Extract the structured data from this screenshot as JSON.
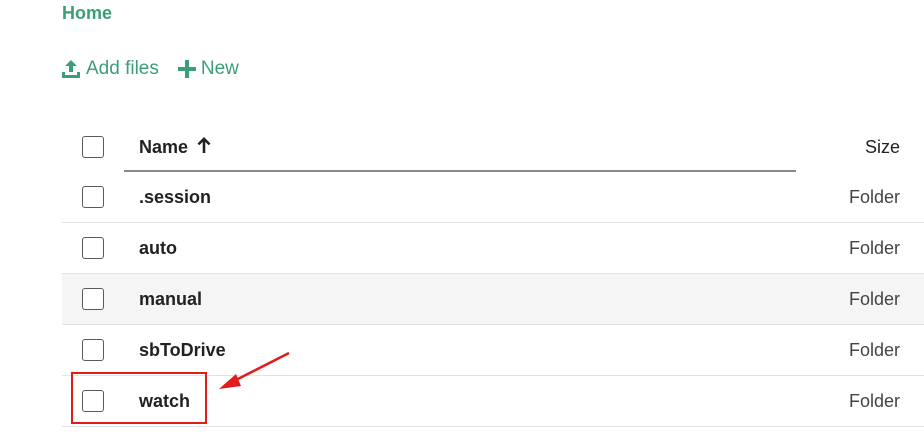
{
  "breadcrumb": {
    "label": "Home"
  },
  "toolbar": {
    "add_files_label": "Add files",
    "new_label": "New"
  },
  "table": {
    "columns": {
      "name": "Name",
      "size": "Size",
      "sort_direction": "ascending"
    },
    "rows": [
      {
        "name": ".session",
        "size": "Folder"
      },
      {
        "name": "auto",
        "size": "Folder"
      },
      {
        "name": "manual",
        "size": "Folder"
      },
      {
        "name": "sbToDrive",
        "size": "Folder"
      },
      {
        "name": "watch",
        "size": "Folder"
      }
    ]
  },
  "colors": {
    "accent": "#3c9e76",
    "annotation": "#e31b1b",
    "row_shade": "#f5f5f5"
  },
  "icons": {
    "add_files": "upload-icon",
    "new": "plus-icon",
    "sort": "arrow-up-icon"
  }
}
